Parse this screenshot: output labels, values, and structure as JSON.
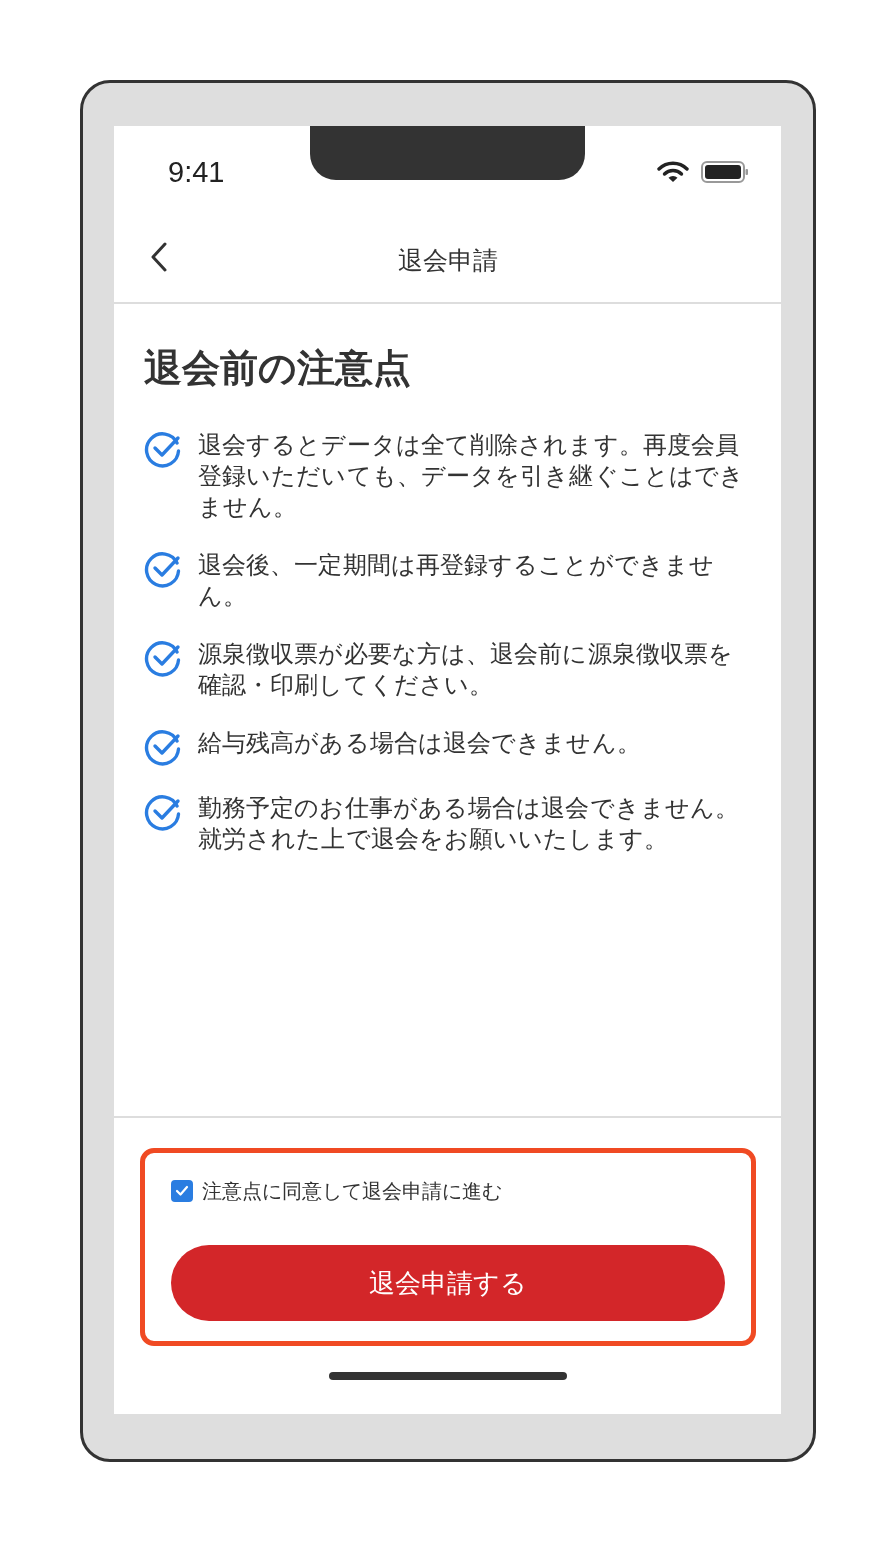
{
  "status_bar": {
    "time": "9:41"
  },
  "nav": {
    "title": "退会申請"
  },
  "heading": "退会前の注意点",
  "notes": [
    {
      "text": "退会するとデータは全て削除されます。再度会員登録いただいても、データを引き継ぐことはできません。"
    },
    {
      "text": "退会後、一定期間は再登録することができません。"
    },
    {
      "text": "源泉徴収票が必要な方は、退会前に源泉徴収票を確認・印刷してください。"
    },
    {
      "text": "給与残高がある場合は退会できません。"
    },
    {
      "text": "勤務予定のお仕事がある場合は退会できません。就労された上で退会をお願いいたします。"
    }
  ],
  "agreement": {
    "label": "注意点に同意して退会申請に進む",
    "checked": true
  },
  "submit_button": {
    "label": "退会申請する"
  }
}
